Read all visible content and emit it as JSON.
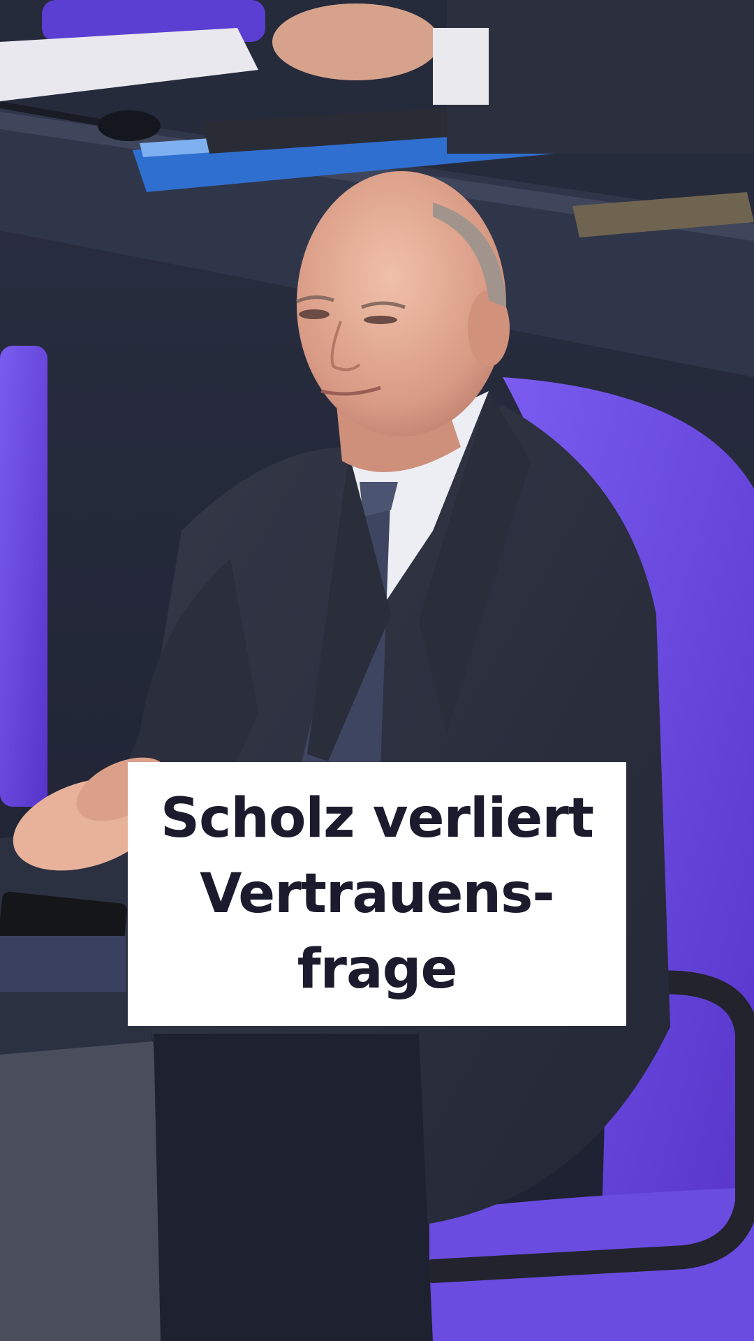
{
  "headline": {
    "line1": "Scholz verliert",
    "line2": "Vertrauens-",
    "line3": "frage"
  },
  "colors": {
    "box_background": "#ffffff",
    "headline_text": "#1c1b2e",
    "chair_accent": "#6a4ce0",
    "suit": "#2a2d3b",
    "desk": "#2c3142"
  }
}
